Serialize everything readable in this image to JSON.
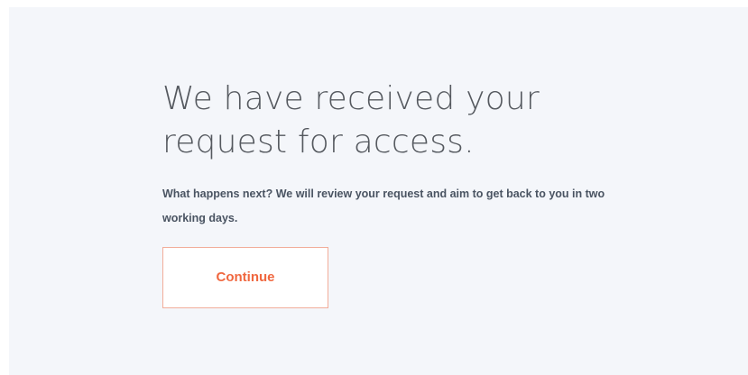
{
  "confirmation": {
    "headline": "We have received your request for access.",
    "body": "What happens next? We will review your request and aim to get back to you in two working days.",
    "continue_label": "Continue"
  },
  "colors": {
    "background": "#f4f6fa",
    "accent": "#f0673f",
    "button_border": "#f2ad9a",
    "headline_text": "#55595f",
    "body_text": "#4a5462"
  }
}
